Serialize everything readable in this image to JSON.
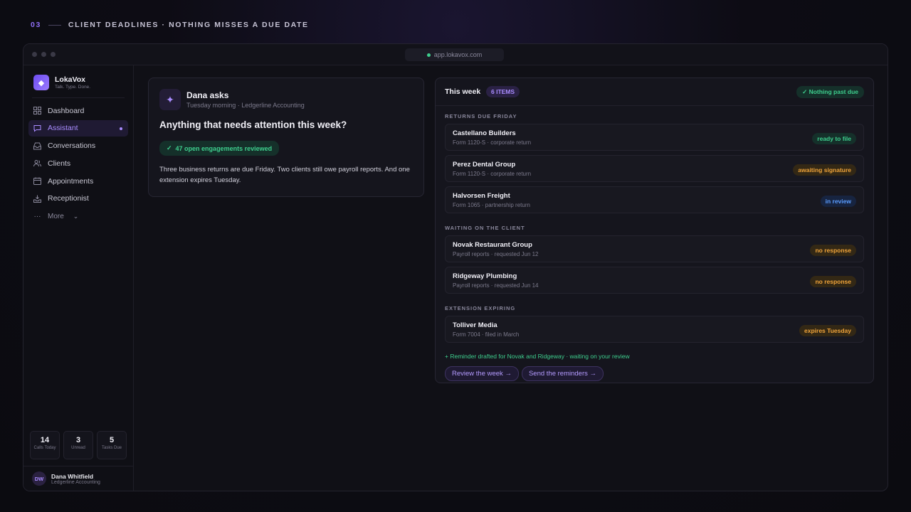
{
  "slide": {
    "number": "03",
    "title": "CLIENT DEADLINES · NOTHING MISSES A DUE DATE"
  },
  "browser": {
    "url": "app.lokavox.com"
  },
  "brand": {
    "name": "LokaVox",
    "tagline": "Talk. Type. Done."
  },
  "nav": {
    "items": [
      {
        "label": "Dashboard",
        "icon": "grid-icon"
      },
      {
        "label": "Assistant",
        "icon": "chat-icon",
        "active": true
      },
      {
        "label": "Conversations",
        "icon": "inbox-icon"
      },
      {
        "label": "Clients",
        "icon": "users-icon"
      },
      {
        "label": "Appointments",
        "icon": "calendar-icon"
      },
      {
        "label": "Receptionist",
        "icon": "phone-icon"
      }
    ],
    "more_label": "More"
  },
  "stats": [
    {
      "value": "14",
      "label": "Calls Today"
    },
    {
      "value": "3",
      "label": "Unread"
    },
    {
      "value": "5",
      "label": "Tasks Due"
    }
  ],
  "user": {
    "initials": "DW",
    "name": "Dana Whitfield",
    "org": "Ledgerline Accounting"
  },
  "ask": {
    "name": "Dana asks",
    "subtitle": "Tuesday morning · Ledgerline Accounting",
    "question": "Anything that needs attention this week?",
    "reviewed": "47 open engagements reviewed",
    "body": "Three business returns are due Friday. Two clients still owe payroll reports. And one extension expires Tuesday."
  },
  "week": {
    "title": "This week",
    "count": "6 ITEMS",
    "status": "Nothing past due",
    "sections": [
      {
        "label": "RETURNS DUE FRIDAY",
        "rows": [
          {
            "name": "Castellano Builders",
            "sub": "Form 1120-S · corporate return",
            "badge": "ready to file",
            "tone": "green"
          },
          {
            "name": "Perez Dental Group",
            "sub": "Form 1120-S · corporate return",
            "badge": "awaiting signature",
            "tone": "amber"
          },
          {
            "name": "Halvorsen Freight",
            "sub": "Form 1065 · partnership return",
            "badge": "in review",
            "tone": "blue"
          }
        ]
      },
      {
        "label": "WAITING ON THE CLIENT",
        "rows": [
          {
            "name": "Novak Restaurant Group",
            "sub": "Payroll reports · requested Jun 12",
            "badge": "no response",
            "tone": "amber"
          },
          {
            "name": "Ridgeway Plumbing",
            "sub": "Payroll reports · requested Jun 14",
            "badge": "no response",
            "tone": "amber"
          }
        ]
      },
      {
        "label": "EXTENSION EXPIRING",
        "rows": [
          {
            "name": "Tolliver Media",
            "sub": "Form 7004 · filed in March",
            "badge": "expires Tuesday",
            "tone": "amber"
          }
        ]
      }
    ],
    "reminder": "+ Reminder drafted for Novak and Ridgeway · waiting on your review",
    "actions": [
      "Review the week",
      "Send the reminders"
    ]
  }
}
